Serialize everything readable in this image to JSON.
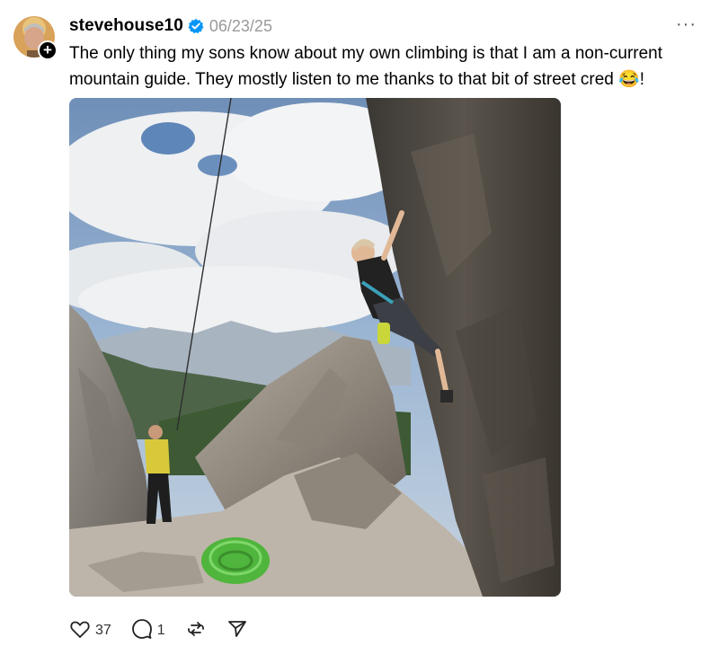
{
  "post": {
    "username": "stevehouse10",
    "date": "06/23/25",
    "caption": "The only thing my sons know about my own climbing is that I am a non-current mountain guide. They mostly listen to me thanks to that bit of street cred 😂!",
    "more_label": "···",
    "follow_symbol": "+",
    "icons": {
      "avatar": "profile-avatar",
      "verified": "verified-badge-icon",
      "like": "heart-icon",
      "comment": "comment-bubble-icon",
      "repost": "repost-icon",
      "share": "send-icon"
    },
    "stats": {
      "likes": "37",
      "comments": "1"
    },
    "colors": {
      "verified_blue": "#0095f6",
      "date_gray": "#999999"
    }
  }
}
